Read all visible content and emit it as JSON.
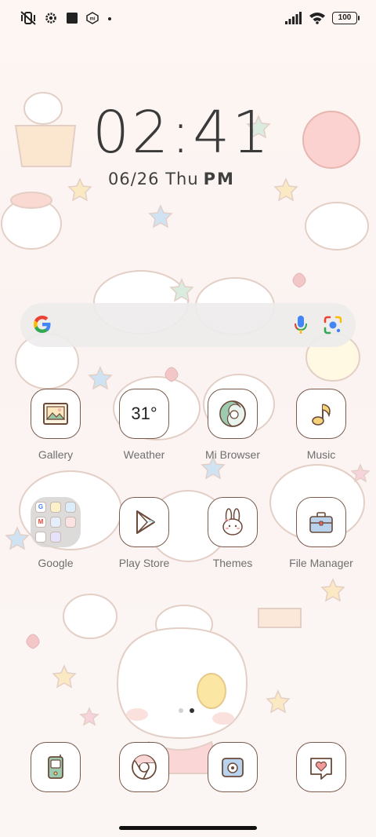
{
  "status_bar": {
    "battery": "100",
    "left_icons": [
      "vibrate-off-icon",
      "settings-gear-icon",
      "square-icon",
      "mi-icon",
      "dot-icon"
    ],
    "right_icons": [
      "signal-icon",
      "wifi-icon",
      "battery-icon"
    ]
  },
  "clock": {
    "time": "02:41",
    "date": "06/26 Thu",
    "ampm": "PM"
  },
  "search_bar": {
    "icons": [
      "google-g-icon",
      "mic-icon",
      "lens-icon"
    ]
  },
  "apps_row1": [
    {
      "label": "Gallery",
      "icon": "gallery-icon"
    },
    {
      "label": "Weather",
      "icon": "weather-icon",
      "value": "31°"
    },
    {
      "label": "Mi Browser",
      "icon": "browser-icon"
    },
    {
      "label": "Music",
      "icon": "music-note-icon"
    }
  ],
  "apps_row2": [
    {
      "label": "Google",
      "icon": "google-folder-icon"
    },
    {
      "label": "Play Store",
      "icon": "play-store-icon"
    },
    {
      "label": "Themes",
      "icon": "bunny-icon"
    },
    {
      "label": "File Manager",
      "icon": "briefcase-icon"
    }
  ],
  "dock": [
    {
      "icon": "phone-icon"
    },
    {
      "icon": "chrome-icon"
    },
    {
      "icon": "camera-icon"
    },
    {
      "icon": "message-heart-icon"
    }
  ],
  "page_indicator": {
    "pages": 2,
    "current": 2
  },
  "colors": {
    "tile_border": "#7a5a4c",
    "label": "#6f6f6f"
  }
}
